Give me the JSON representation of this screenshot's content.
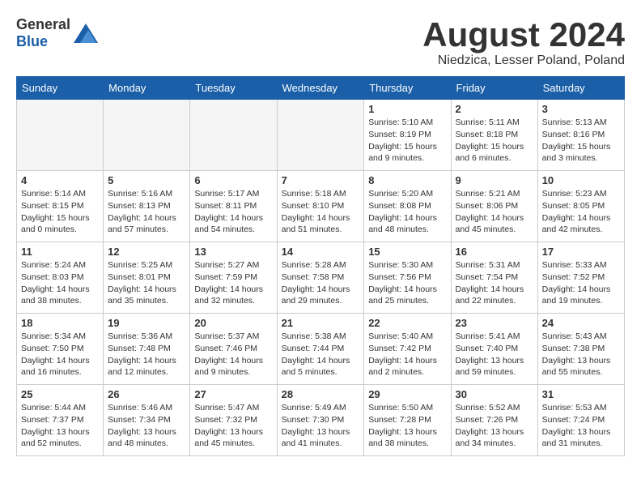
{
  "logo": {
    "general": "General",
    "blue": "Blue"
  },
  "title": "August 2024",
  "location": "Niedzica, Lesser Poland, Poland",
  "weekdays": [
    "Sunday",
    "Monday",
    "Tuesday",
    "Wednesday",
    "Thursday",
    "Friday",
    "Saturday"
  ],
  "weeks": [
    [
      {
        "day": "",
        "info": ""
      },
      {
        "day": "",
        "info": ""
      },
      {
        "day": "",
        "info": ""
      },
      {
        "day": "",
        "info": ""
      },
      {
        "day": "1",
        "info": "Sunrise: 5:10 AM\nSunset: 8:19 PM\nDaylight: 15 hours\nand 9 minutes."
      },
      {
        "day": "2",
        "info": "Sunrise: 5:11 AM\nSunset: 8:18 PM\nDaylight: 15 hours\nand 6 minutes."
      },
      {
        "day": "3",
        "info": "Sunrise: 5:13 AM\nSunset: 8:16 PM\nDaylight: 15 hours\nand 3 minutes."
      }
    ],
    [
      {
        "day": "4",
        "info": "Sunrise: 5:14 AM\nSunset: 8:15 PM\nDaylight: 15 hours\nand 0 minutes."
      },
      {
        "day": "5",
        "info": "Sunrise: 5:16 AM\nSunset: 8:13 PM\nDaylight: 14 hours\nand 57 minutes."
      },
      {
        "day": "6",
        "info": "Sunrise: 5:17 AM\nSunset: 8:11 PM\nDaylight: 14 hours\nand 54 minutes."
      },
      {
        "day": "7",
        "info": "Sunrise: 5:18 AM\nSunset: 8:10 PM\nDaylight: 14 hours\nand 51 minutes."
      },
      {
        "day": "8",
        "info": "Sunrise: 5:20 AM\nSunset: 8:08 PM\nDaylight: 14 hours\nand 48 minutes."
      },
      {
        "day": "9",
        "info": "Sunrise: 5:21 AM\nSunset: 8:06 PM\nDaylight: 14 hours\nand 45 minutes."
      },
      {
        "day": "10",
        "info": "Sunrise: 5:23 AM\nSunset: 8:05 PM\nDaylight: 14 hours\nand 42 minutes."
      }
    ],
    [
      {
        "day": "11",
        "info": "Sunrise: 5:24 AM\nSunset: 8:03 PM\nDaylight: 14 hours\nand 38 minutes."
      },
      {
        "day": "12",
        "info": "Sunrise: 5:25 AM\nSunset: 8:01 PM\nDaylight: 14 hours\nand 35 minutes."
      },
      {
        "day": "13",
        "info": "Sunrise: 5:27 AM\nSunset: 7:59 PM\nDaylight: 14 hours\nand 32 minutes."
      },
      {
        "day": "14",
        "info": "Sunrise: 5:28 AM\nSunset: 7:58 PM\nDaylight: 14 hours\nand 29 minutes."
      },
      {
        "day": "15",
        "info": "Sunrise: 5:30 AM\nSunset: 7:56 PM\nDaylight: 14 hours\nand 25 minutes."
      },
      {
        "day": "16",
        "info": "Sunrise: 5:31 AM\nSunset: 7:54 PM\nDaylight: 14 hours\nand 22 minutes."
      },
      {
        "day": "17",
        "info": "Sunrise: 5:33 AM\nSunset: 7:52 PM\nDaylight: 14 hours\nand 19 minutes."
      }
    ],
    [
      {
        "day": "18",
        "info": "Sunrise: 5:34 AM\nSunset: 7:50 PM\nDaylight: 14 hours\nand 16 minutes."
      },
      {
        "day": "19",
        "info": "Sunrise: 5:36 AM\nSunset: 7:48 PM\nDaylight: 14 hours\nand 12 minutes."
      },
      {
        "day": "20",
        "info": "Sunrise: 5:37 AM\nSunset: 7:46 PM\nDaylight: 14 hours\nand 9 minutes."
      },
      {
        "day": "21",
        "info": "Sunrise: 5:38 AM\nSunset: 7:44 PM\nDaylight: 14 hours\nand 5 minutes."
      },
      {
        "day": "22",
        "info": "Sunrise: 5:40 AM\nSunset: 7:42 PM\nDaylight: 14 hours\nand 2 minutes."
      },
      {
        "day": "23",
        "info": "Sunrise: 5:41 AM\nSunset: 7:40 PM\nDaylight: 13 hours\nand 59 minutes."
      },
      {
        "day": "24",
        "info": "Sunrise: 5:43 AM\nSunset: 7:38 PM\nDaylight: 13 hours\nand 55 minutes."
      }
    ],
    [
      {
        "day": "25",
        "info": "Sunrise: 5:44 AM\nSunset: 7:37 PM\nDaylight: 13 hours\nand 52 minutes."
      },
      {
        "day": "26",
        "info": "Sunrise: 5:46 AM\nSunset: 7:34 PM\nDaylight: 13 hours\nand 48 minutes."
      },
      {
        "day": "27",
        "info": "Sunrise: 5:47 AM\nSunset: 7:32 PM\nDaylight: 13 hours\nand 45 minutes."
      },
      {
        "day": "28",
        "info": "Sunrise: 5:49 AM\nSunset: 7:30 PM\nDaylight: 13 hours\nand 41 minutes."
      },
      {
        "day": "29",
        "info": "Sunrise: 5:50 AM\nSunset: 7:28 PM\nDaylight: 13 hours\nand 38 minutes."
      },
      {
        "day": "30",
        "info": "Sunrise: 5:52 AM\nSunset: 7:26 PM\nDaylight: 13 hours\nand 34 minutes."
      },
      {
        "day": "31",
        "info": "Sunrise: 5:53 AM\nSunset: 7:24 PM\nDaylight: 13 hours\nand 31 minutes."
      }
    ]
  ]
}
